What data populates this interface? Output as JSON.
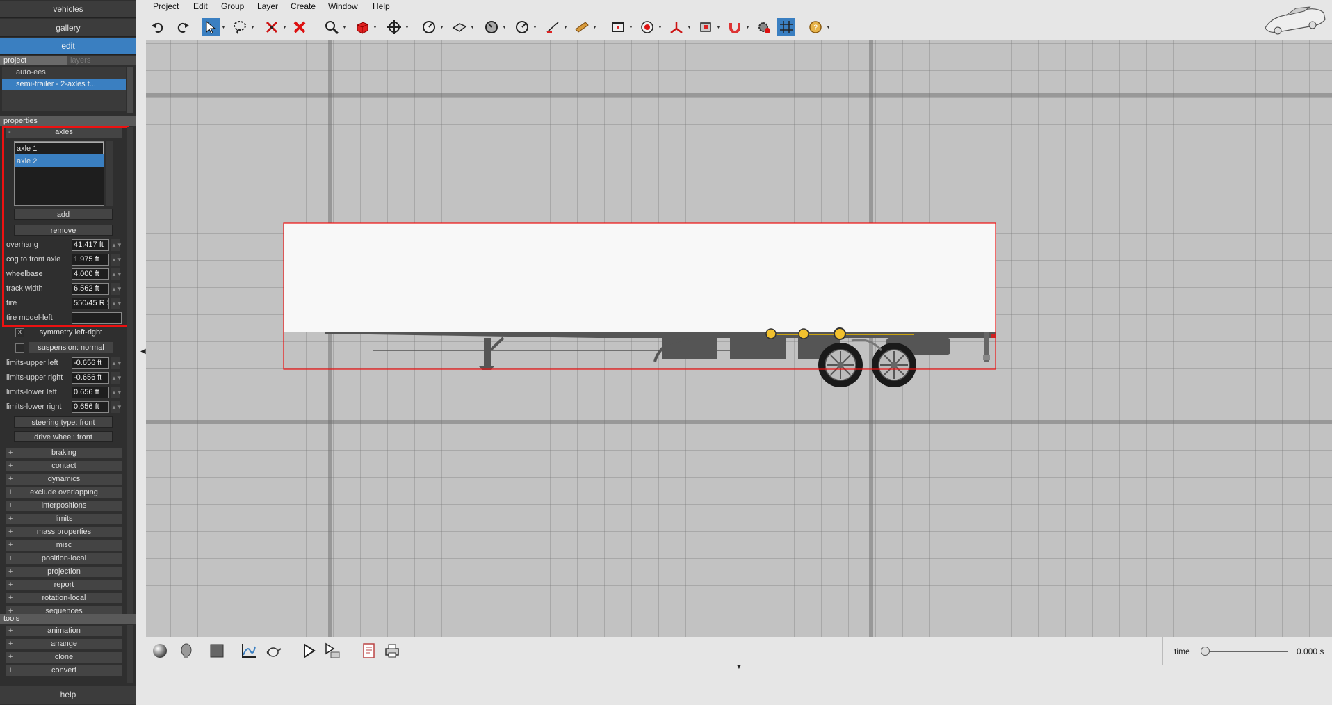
{
  "nav": {
    "vehicles": "vehicles",
    "gallery": "gallery",
    "edit": "edit",
    "help": "help"
  },
  "project_panel": {
    "tabs": [
      "project",
      "layers"
    ],
    "items": [
      "auto-ees",
      "semi-trailer - 2-axles f..."
    ]
  },
  "properties": {
    "header": "properties",
    "axles_group": {
      "toggle": "-",
      "title": "axles",
      "list": [
        "axle 1",
        "axle 2"
      ],
      "add_label": "add",
      "remove_label": "remove"
    },
    "fields": [
      {
        "label": "overhang",
        "value": "41.417 ft"
      },
      {
        "label": "cog to front axle",
        "value": "1.975 ft"
      },
      {
        "label": "wheelbase",
        "value": "4.000 ft"
      },
      {
        "label": "track width",
        "value": "6.562 ft"
      },
      {
        "label": "tire",
        "value": "550/45 R 2"
      },
      {
        "label": "tire model-left",
        "value": ""
      }
    ],
    "symmetry_label": "symmetry left-right",
    "symmetry_mark": "X",
    "suspension_label": "suspension: normal",
    "limits": [
      {
        "label": "limits-upper left",
        "value": "-0.656 ft"
      },
      {
        "label": "limits-upper right",
        "value": "-0.656 ft"
      },
      {
        "label": "limits-lower left",
        "value": "0.656 ft"
      },
      {
        "label": "limits-lower right",
        "value": "0.656 ft"
      }
    ],
    "steering_label": "steering type: front",
    "drive_label": "drive wheel: front",
    "collapsed": [
      "braking",
      "contact",
      "dynamics",
      "exclude overlapping",
      "interpositions",
      "limits",
      "mass properties",
      "misc",
      "position-local",
      "projection",
      "report",
      "rotation-local",
      "sequences"
    ]
  },
  "tools": {
    "header": "tools",
    "collapsed": [
      "animation",
      "arrange",
      "clone",
      "convert"
    ]
  },
  "menu": [
    "Project",
    "Edit",
    "Group",
    "Layer",
    "Create",
    "Window",
    "Help"
  ],
  "timeline": {
    "label": "time",
    "value": "0.000 s",
    "progress": 0
  },
  "colors": {
    "accent": "#3a7fc1",
    "highlight": "#e11111",
    "panel": "#2f2f2f",
    "viewport": "#c2c2c2"
  }
}
